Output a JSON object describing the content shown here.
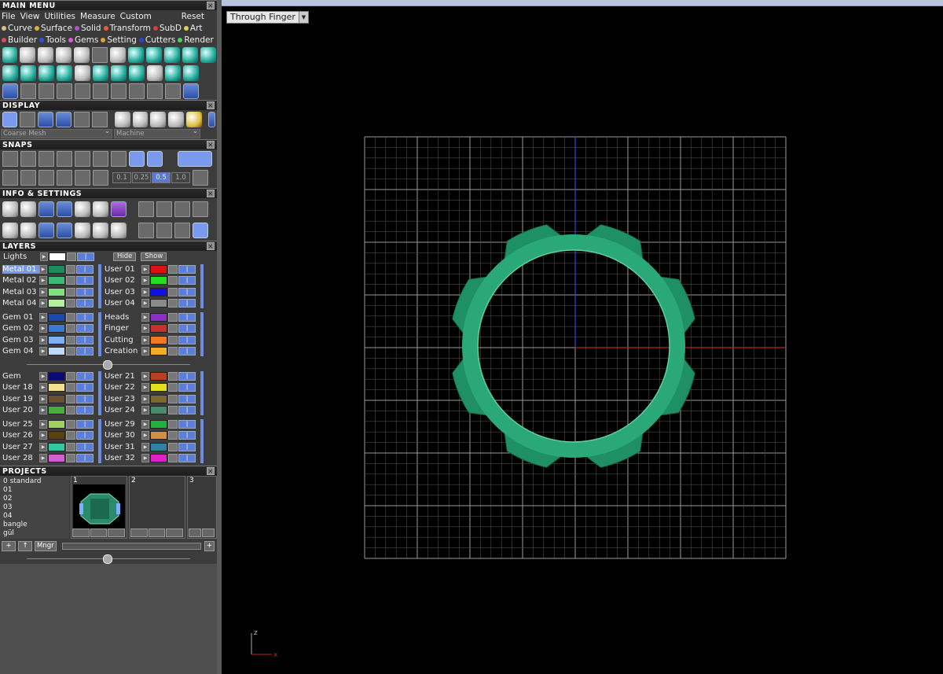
{
  "main_menu": {
    "title": "MAIN MENU",
    "menus": [
      "File",
      "View",
      "Utilities",
      "Measure",
      "Custom"
    ],
    "reset": "Reset",
    "categories_row1": [
      {
        "label": "Curve",
        "color": "#d8c08a"
      },
      {
        "label": "Surface",
        "color": "#e0b030"
      },
      {
        "label": "Solid",
        "color": "#b050d0"
      },
      {
        "label": "Transform",
        "color": "#e06030"
      },
      {
        "label": "SubD",
        "color": "#d04040"
      },
      {
        "label": "Art",
        "color": "#e0d050"
      }
    ],
    "categories_row2": [
      {
        "label": "Builder",
        "color": "#d05060"
      },
      {
        "label": "Tools",
        "color": "#3050e0"
      },
      {
        "label": "Gems",
        "color": "#d060d0"
      },
      {
        "label": "Setting",
        "color": "#e0a040"
      },
      {
        "label": "Cutters",
        "color": "#3040d0"
      },
      {
        "label": "Render",
        "color": "#50d060"
      }
    ]
  },
  "display": {
    "title": "DISPLAY",
    "mesh_option": "Coarse Mesh",
    "material_option": "Machine"
  },
  "snaps": {
    "title": "SNAPS",
    "values": [
      "0.1",
      "0.25",
      "0.5",
      "1.0"
    ],
    "active_value": "0.5"
  },
  "info": {
    "title": "INFO & SETTINGS"
  },
  "layers": {
    "title": "LAYERS",
    "lights": "Lights",
    "hide": "Hide",
    "show": "Show",
    "groups": [
      {
        "left": [
          {
            "name": "Metal 01",
            "color": "#1e8a5a",
            "selected": true
          },
          {
            "name": "Metal 02",
            "color": "#3cb878"
          },
          {
            "name": "Metal 03",
            "color": "#7ee07e"
          },
          {
            "name": "Metal 04",
            "color": "#b0f0a0"
          }
        ],
        "right": [
          {
            "name": "User 01",
            "color": "#e01010"
          },
          {
            "name": "User 02",
            "color": "#20e020"
          },
          {
            "name": "User 03",
            "color": "#1010e0"
          },
          {
            "name": "User 04",
            "color": "#8a8a8a"
          }
        ]
      },
      {
        "left": [
          {
            "name": "Gem 01",
            "color": "#1a4ab0"
          },
          {
            "name": "Gem 02",
            "color": "#3a78d8"
          },
          {
            "name": "Gem 03",
            "color": "#80b0f0"
          },
          {
            "name": "Gem 04",
            "color": "#c0d8f8"
          }
        ],
        "right": [
          {
            "name": "Heads",
            "color": "#8a30c8"
          },
          {
            "name": "Finger",
            "color": "#c83030"
          },
          {
            "name": "Cutting",
            "color": "#f07820"
          },
          {
            "name": "Creation",
            "color": "#f0b020"
          }
        ]
      },
      {
        "left": [
          {
            "name": "Gem",
            "color": "#0a0a70"
          },
          {
            "name": "User 18",
            "color": "#f0e090"
          },
          {
            "name": "User 19",
            "color": "#6a5030"
          },
          {
            "name": "User 20",
            "color": "#40b040"
          }
        ],
        "right": [
          {
            "name": "User 21",
            "color": "#b84020"
          },
          {
            "name": "User 22",
            "color": "#e0e020"
          },
          {
            "name": "User 23",
            "color": "#7a6a30"
          },
          {
            "name": "User 24",
            "color": "#4a8a6a"
          }
        ]
      },
      {
        "left": [
          {
            "name": "User 25",
            "color": "#a0d060"
          },
          {
            "name": "User 26",
            "color": "#5a4010"
          },
          {
            "name": "User 27",
            "color": "#30c8a0"
          },
          {
            "name": "User 28",
            "color": "#d060d0"
          }
        ],
        "right": [
          {
            "name": "User 29",
            "color": "#20b040"
          },
          {
            "name": "User 30",
            "color": "#d09040"
          },
          {
            "name": "User 31",
            "color": "#3080a0"
          },
          {
            "name": "User 32",
            "color": "#e020c0"
          }
        ]
      }
    ]
  },
  "projects": {
    "title": "PROJECTS",
    "list": [
      "0 standard",
      "01",
      "02",
      "03",
      "04",
      "bangle",
      "gül"
    ],
    "slots": [
      "1",
      "2",
      "3"
    ],
    "manager": "Mngr"
  },
  "viewport": {
    "view_dropdown": "Through Finger",
    "axis_z": "z",
    "axis_x": "x"
  }
}
